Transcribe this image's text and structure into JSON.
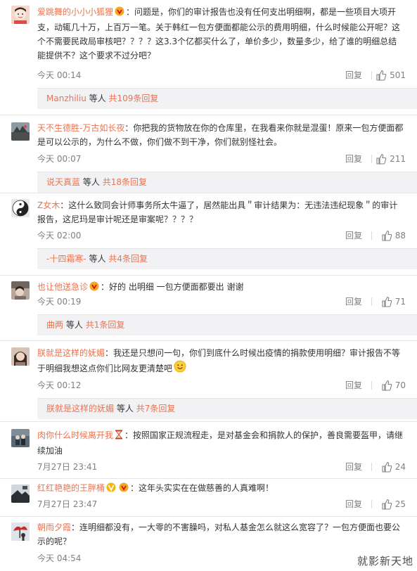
{
  "comments": [
    {
      "user": "爱跳舞的小小小狐狸",
      "text": "：问题是，你们的审计报告也没有任何支出明细啊，都是一些项目大项开支，动辄几十万，上百万一笔。关于韩红一包方便面都能公示的费用明细，什么时候能公开呢？这个不需要民政局审核吧？？？？这3.3个亿都买什么了，单价多少，数量多少，给了谁的明细总结能提供不？这个要求不过分吧？",
      "time": "今天 00:14",
      "reply_label": "回复",
      "likes": "501",
      "sub": {
        "name": "Manzhiliu",
        "mid": "等人",
        "count": "共109条回复"
      }
    },
    {
      "user": "天不生德胜-万古如长夜",
      "text": "：你把我的货物放在你的仓库里，在我看来你就是混蛋！原来一包方便面都是可以公示的，为什么不做，你们做不到干净，你们就别怪社会。",
      "time": "今天 00:07",
      "reply_label": "回复",
      "likes": "211",
      "sub": {
        "name": "说天真蓝",
        "mid": "等人",
        "count": "共18条回复"
      }
    },
    {
      "user": "Z女木",
      "text": "：这什么致同会计师事务所太牛逼了，居然能出具＂审计结果为：无违法违纪现象＂的审计报告，这尼玛是审计呢还是审案呢？？？？",
      "time": "今天 02:00",
      "reply_label": "回复",
      "likes": "88",
      "sub": {
        "name": "-十四霜寒-",
        "mid": "等人",
        "count": "共4条回复"
      }
    },
    {
      "user": "也让他送急诊",
      "text": "：好的 出明细 一包方便面都要出 谢谢",
      "time": "今天 00:19",
      "reply_label": "回复",
      "likes": "71",
      "sub": {
        "name": "曲两",
        "mid": "等人",
        "count": "共1条回复"
      }
    },
    {
      "user": "朕就是这样的妩媚",
      "text": "：我还是只想问一句，你们到底什么时候出疫情的捐款使用明细？审计报告不等于明细我想这点你们比网友更清楚吧",
      "time": "今天 00:12",
      "reply_label": "回复",
      "likes": "70",
      "sub": {
        "name": "朕就是这样的妩媚",
        "mid": "等人",
        "count": "共7条回复"
      }
    },
    {
      "user": "肉你什么时候离开我",
      "text": "：按照国家正规流程走，是对基金会和捐款人的保护，善良需要盔甲，请继续加油",
      "time": "7月27日 23:41",
      "reply_label": "回复",
      "likes": "24"
    },
    {
      "user": "红红艳艳的王胖桶",
      "text": "：这年头实实在在做慈善的人真难啊！",
      "time": "7月27日 23:47",
      "reply_label": "回复",
      "likes": "25"
    },
    {
      "user": "朝雨夕霞",
      "text": "：连明细都没有，一大零的不害臊吗，对私人基金怎么就这么宽容了？一包方便面也要公示的呢？",
      "time": "今天 04:54",
      "reply_label": "回复",
      "likes": ""
    }
  ],
  "watermark": "就影新天地",
  "colors": {
    "link": "#eb7350",
    "meta": "#808080",
    "sub_bg": "#f2f2f5"
  }
}
